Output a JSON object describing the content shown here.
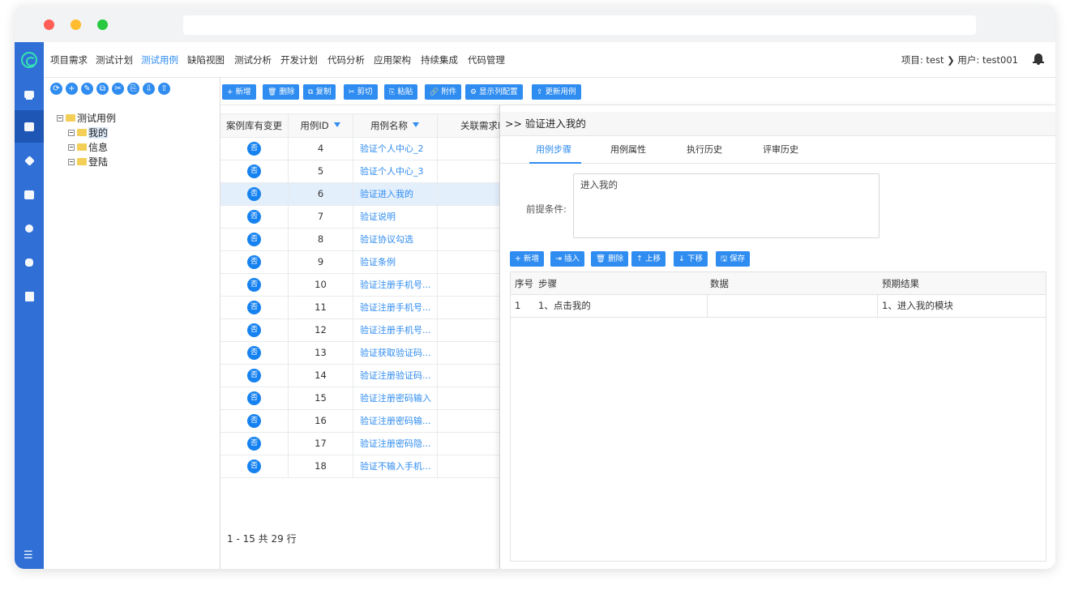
{
  "nav": {
    "items": [
      "项目需求",
      "测试计划",
      "测试用例",
      "缺陷视图",
      "测试分析",
      "开发计划",
      "代码分析",
      "应用架构",
      "持续集成",
      "代码管理"
    ],
    "active_index": 2,
    "project_user": "项目: test ❯ 用户: test001",
    "accent_color": "#2f8cf0",
    "rail_color": "#2f6fd6"
  },
  "rail": {
    "icons": [
      "logo-icon",
      "monitor-icon",
      "case-icon",
      "layers-icon",
      "print-icon",
      "clock-icon",
      "database-icon",
      "book-icon",
      "menu-icon"
    ],
    "active_index": 1
  },
  "tree": {
    "toolbar_icons": [
      "refresh-icon",
      "add-icon",
      "edit-icon",
      "copy-icon",
      "cut-icon",
      "paste-icon",
      "import-icon",
      "export-icon"
    ],
    "root": "测试用例",
    "children": [
      "我的",
      "信息",
      "登陆"
    ],
    "selected_index": 0
  },
  "toolbar": {
    "buttons": [
      {
        "glyph": "+",
        "label": "新增"
      },
      {
        "glyph": "🗑",
        "label": "删除"
      },
      {
        "glyph": "⧉",
        "label": "复制"
      },
      {
        "glyph": "✂",
        "label": "剪切"
      },
      {
        "glyph": "⎘",
        "label": "粘贴"
      },
      {
        "glyph": "🔗",
        "label": "附件"
      },
      {
        "glyph": "⚙",
        "label": "显示列配置"
      },
      {
        "glyph": "⇪",
        "label": "更新用例"
      }
    ]
  },
  "table": {
    "columns": [
      "案例库有变更",
      "用例ID",
      "用例名称",
      "关联需求I"
    ],
    "rows": [
      {
        "changed": "否",
        "id": "4",
        "name": "验证个人中心_2"
      },
      {
        "changed": "否",
        "id": "5",
        "name": "验证个人中心_3"
      },
      {
        "changed": "否",
        "id": "6",
        "name": "验证进入我的"
      },
      {
        "changed": "否",
        "id": "7",
        "name": "验证说明"
      },
      {
        "changed": "否",
        "id": "8",
        "name": "验证协议勾选"
      },
      {
        "changed": "否",
        "id": "9",
        "name": "验证条例"
      },
      {
        "changed": "否",
        "id": "10",
        "name": "验证注册手机号..."
      },
      {
        "changed": "否",
        "id": "11",
        "name": "验证注册手机号..."
      },
      {
        "changed": "否",
        "id": "12",
        "name": "验证注册手机号..."
      },
      {
        "changed": "否",
        "id": "13",
        "name": "验证获取验证码..."
      },
      {
        "changed": "否",
        "id": "14",
        "name": "验证注册验证码..."
      },
      {
        "changed": "否",
        "id": "15",
        "name": "验证注册密码输入"
      },
      {
        "changed": "否",
        "id": "16",
        "name": "验证注册密码输..."
      },
      {
        "changed": "否",
        "id": "17",
        "name": "验证注册密码隐..."
      },
      {
        "changed": "否",
        "id": "18",
        "name": "验证不输入手机..."
      }
    ],
    "selected_index": 2,
    "pager": "1 - 15 共 29 行"
  },
  "detail": {
    "title": ">>  验证进入我的",
    "tabs": [
      "用例步骤",
      "用例属性",
      "执行历史",
      "评审历史"
    ],
    "active_tab": 0,
    "precondition_label": "前提条件:",
    "precondition_value": "进入我的",
    "step_buttons": [
      {
        "glyph": "+",
        "label": "新增"
      },
      {
        "glyph": "⇥",
        "label": "插入"
      },
      {
        "glyph": "🗑",
        "label": "删除"
      },
      {
        "glyph": "↑",
        "label": "上移"
      },
      {
        "glyph": "↓",
        "label": "下移"
      },
      {
        "glyph": "🖫",
        "label": "保存"
      }
    ],
    "step_columns": [
      "序号",
      "步骤",
      "数据",
      "预期结果"
    ],
    "steps": [
      {
        "no": "1",
        "step": "1、点击我的",
        "data": "",
        "expected": "1、进入我的模块"
      }
    ]
  }
}
